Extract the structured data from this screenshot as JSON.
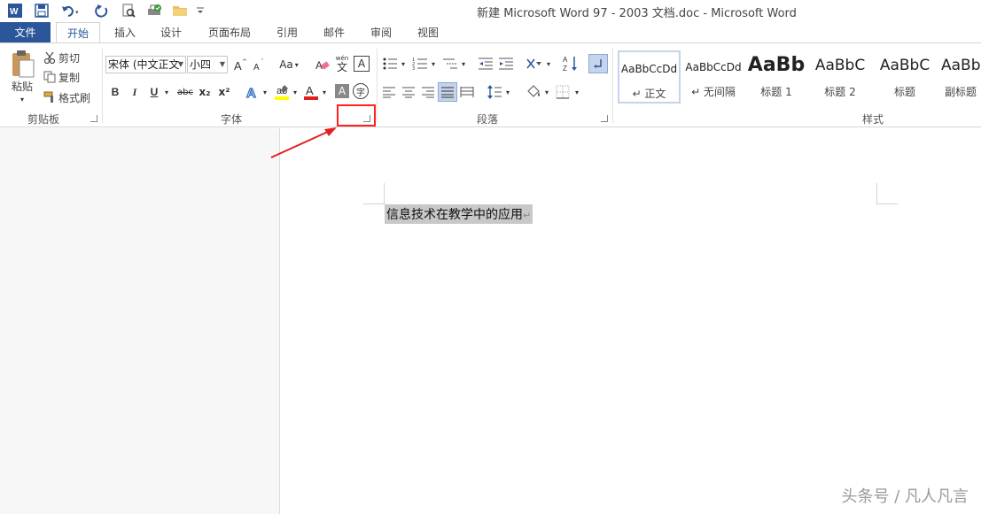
{
  "title_bar": {
    "title": "新建 Microsoft Word 97 - 2003 文档.doc - Microsoft Word",
    "icons": [
      "word-icon",
      "save-icon",
      "undo-icon",
      "redo-icon",
      "print-preview-icon",
      "quick-print-icon",
      "folder-icon",
      "customize-icon"
    ]
  },
  "tabs": [
    "文件",
    "开始",
    "插入",
    "设计",
    "页面布局",
    "引用",
    "邮件",
    "审阅",
    "视图"
  ],
  "active_tab": "开始",
  "clipboard": {
    "paste": "粘贴",
    "cut": "剪切",
    "copy": "复制",
    "format_painter": "格式刷",
    "label": "剪贴板"
  },
  "font": {
    "font_name": "宋体 (中文正文",
    "font_size": "小四",
    "label": "字体",
    "change_case": "Aa",
    "bold": "B",
    "italic": "I",
    "underline": "U",
    "strike": "abc",
    "subscript": "x₂",
    "superscript": "x²",
    "phonetic": "wén",
    "phonetic_char": "文",
    "char_border": "A",
    "char_shading": "A",
    "enclose": "字",
    "highlight_color": "#ffff00",
    "font_color": "#e02020"
  },
  "paragraph": {
    "label": "段落"
  },
  "styles": {
    "label": "样式",
    "items": [
      {
        "sample": "AaBbCcDd",
        "name": "↵ 正文"
      },
      {
        "sample": "AaBbCcDd",
        "name": "↵ 无间隔"
      },
      {
        "sample": "AaBb",
        "name": "标题 1"
      },
      {
        "sample": "AaBbC",
        "name": "标题 2"
      },
      {
        "sample": "AaBbC",
        "name": "标题"
      },
      {
        "sample": "AaBb",
        "name": "副标题"
      }
    ]
  },
  "document": {
    "text": "信息技术在教学中的应用",
    "para_mark": "↵"
  },
  "annotation": {
    "highlight_color": "#ff2020"
  },
  "watermark": "头条号 / 凡人凡言"
}
